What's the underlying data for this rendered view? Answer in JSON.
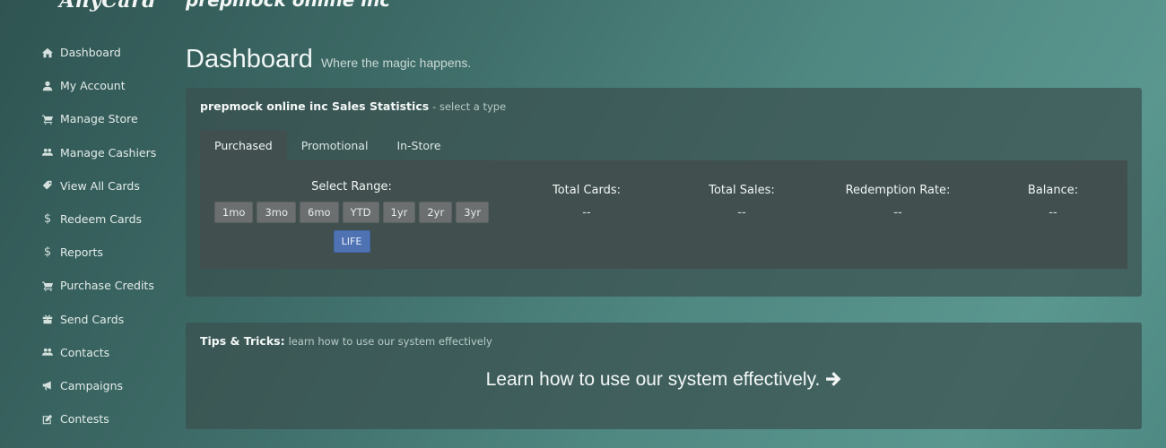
{
  "header": {
    "brand": "AnyCard",
    "company": "prepmock online inc"
  },
  "sidebar": {
    "items": [
      {
        "label": "Dashboard",
        "icon": "home-icon"
      },
      {
        "label": "My Account",
        "icon": "user-icon"
      },
      {
        "label": "Manage Store",
        "icon": "cart-icon"
      },
      {
        "label": "Manage Cashiers",
        "icon": "users-icon"
      },
      {
        "label": "View All Cards",
        "icon": "tag-icon"
      },
      {
        "label": "Redeem Cards",
        "icon": "dollar-icon"
      },
      {
        "label": "Reports",
        "icon": "dollar-icon"
      },
      {
        "label": "Purchase Credits",
        "icon": "cart-icon"
      },
      {
        "label": "Send Cards",
        "icon": "gift-icon"
      },
      {
        "label": "Contacts",
        "icon": "users-icon"
      },
      {
        "label": "Campaigns",
        "icon": "bullhorn-icon"
      },
      {
        "label": "Contests",
        "icon": "edit-icon"
      }
    ]
  },
  "main": {
    "title": "Dashboard",
    "subtitle": "Where the magic happens.",
    "stats_panel": {
      "title": "prepmock online inc Sales Statistics",
      "hint": "- select a type",
      "tabs": [
        {
          "label": "Purchased",
          "active": true
        },
        {
          "label": "Promotional",
          "active": false
        },
        {
          "label": "In-Store",
          "active": false
        }
      ],
      "range_label": "Select Range:",
      "range_buttons": [
        "1mo",
        "3mo",
        "6mo",
        "YTD",
        "1yr",
        "2yr",
        "3yr"
      ],
      "life_button": "LIFE",
      "stats": [
        {
          "label": "Total Cards:",
          "value": "--"
        },
        {
          "label": "Total Sales:",
          "value": "--"
        },
        {
          "label": "Redemption Rate:",
          "value": "--"
        },
        {
          "label": "Balance:",
          "value": "--"
        }
      ]
    },
    "tips_panel": {
      "title": "Tips & Tricks:",
      "hint": "learn how to use our system effectively",
      "link": "Learn how to use our system effectively."
    }
  },
  "colors": {
    "life_button": "#4f72b3",
    "range_button": "#6b6f6f",
    "panel": "#3a504f"
  }
}
